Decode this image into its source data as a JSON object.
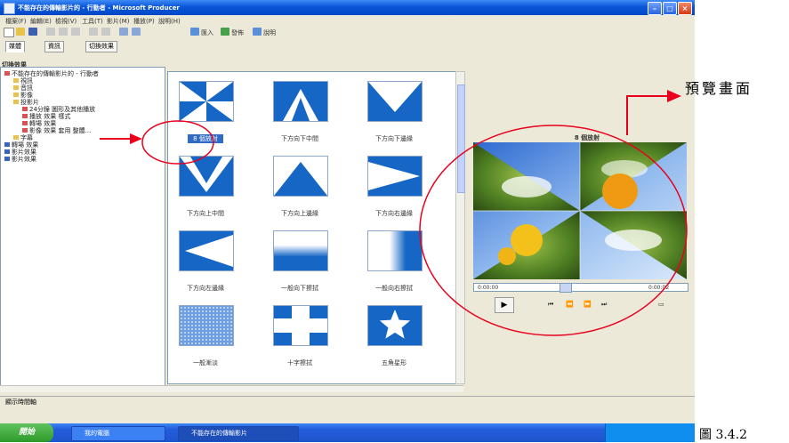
{
  "window": {
    "title": "不能存在的傳輸影片的 - 行動者 - Microsoft Producer"
  },
  "menu": [
    "檔案(F)",
    "編輯(E)",
    "檢視(V)",
    "工具(T)",
    "影片(M)",
    "播放(P)",
    "說明(H)"
  ],
  "toolbar": {
    "btn1_label": "匯入",
    "btn2_label": "發佈",
    "btn3_label": "說明"
  },
  "tabs": [
    "媒體",
    "資訊",
    "切換效果"
  ],
  "panel_title": "切換效果",
  "tree": [
    "不能存在的傳輸影片的 - 行動者",
    "視訊",
    "音訊",
    "影像",
    "投影片",
    "24分鐘 圖形及其他播放",
    "播放 效果 樣式",
    "轉場 效果",
    "影像 效果 套用 整體...",
    "字幕",
    "轉場 效果",
    "影片效果",
    "影片效果"
  ],
  "transitions": [
    "8 個放射",
    "下方向下中間",
    "下方向下邊緣",
    "下方向上中間",
    "下方向上邊緣",
    "下方向右邊緣",
    "下方向左邊緣",
    "一般向下擦拭",
    "一般向右擦拭",
    "一般漸淡",
    "十字擦拭",
    "五角星形"
  ],
  "preview": {
    "title": "8 個放射",
    "time_start": "0:00:00",
    "time_end": "0:00:02"
  },
  "storyboard_label": "顯示時間軸",
  "taskbar": {
    "start_label": "開始",
    "task1_label": "我的電腦",
    "task2_label": "不能存在的傳輸影片"
  },
  "annotation": {
    "preview_label": "預覽畫面",
    "figure_label": "圖 3.4.2"
  },
  "colors": {
    "accent_blue": "#1666c6",
    "annotation_red": "#e8001c"
  }
}
